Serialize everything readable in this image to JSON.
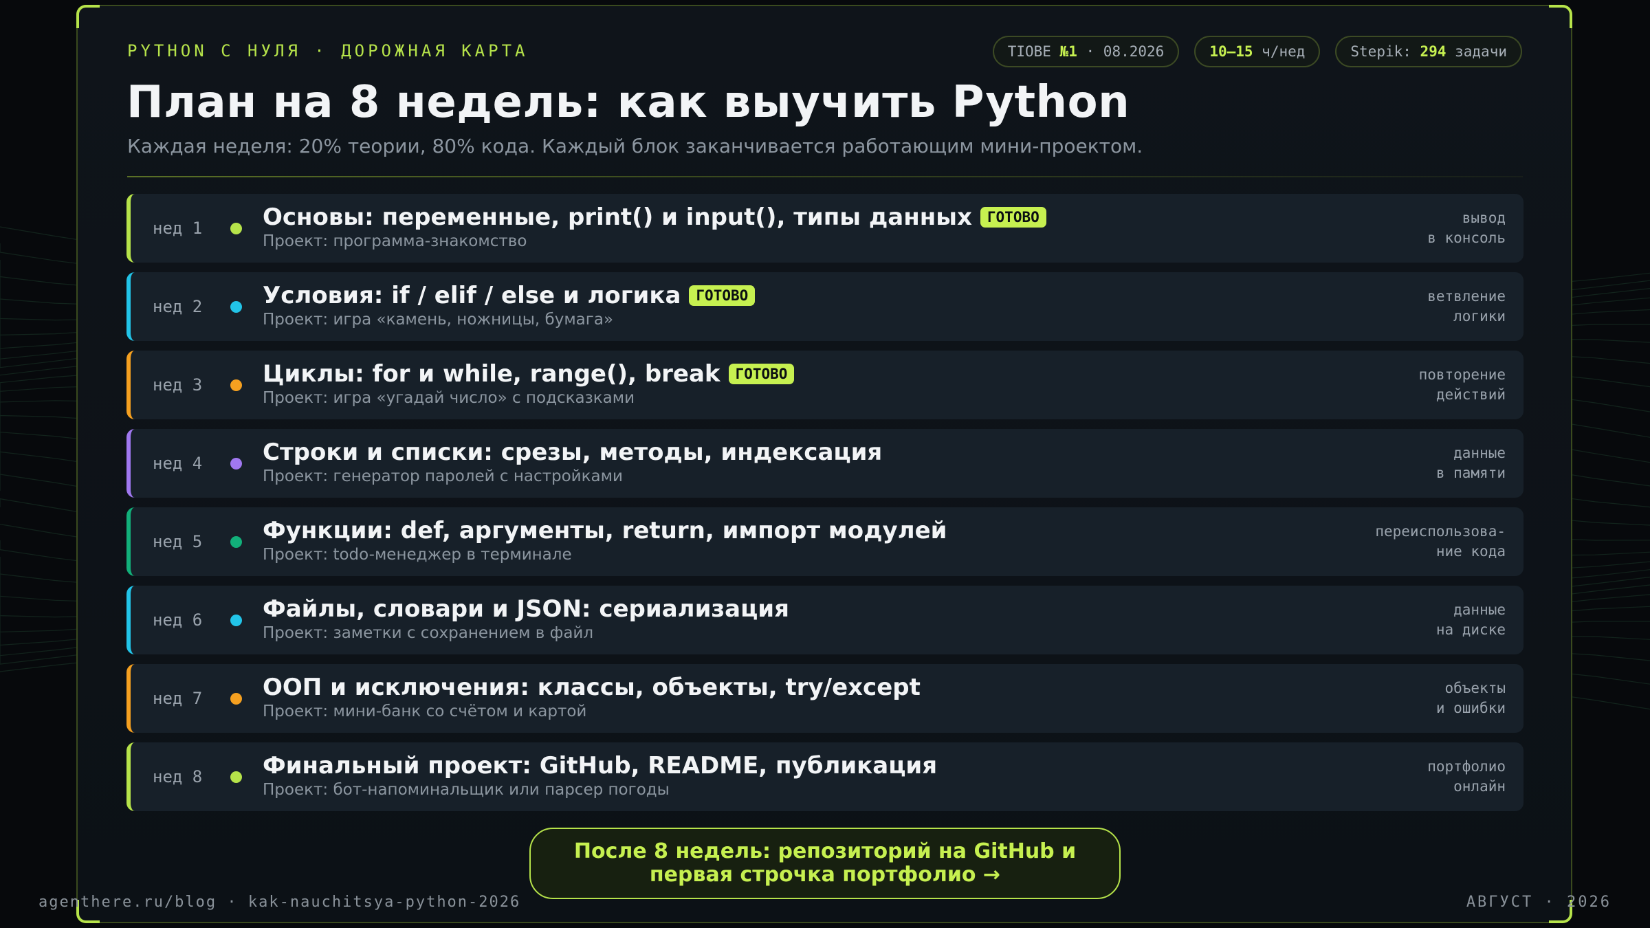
{
  "header": {
    "kicker": "PYTHON С НУЛЯ · ДОРОЖНАЯ КАРТА",
    "pills": [
      {
        "pre": "TIOBE ",
        "bold": "№1",
        "post": " · 08.2026"
      },
      {
        "pre": "",
        "bold": "10–15",
        "post": " ч/нед"
      },
      {
        "pre": "Stepik: ",
        "bold": "294",
        "post": " задачи"
      }
    ],
    "title": "План на 8 недель: как выучить Python",
    "subtitle": "Каждая неделя: 20% теории, 80% кода. Каждый блок заканчивается работающим мини-проектом."
  },
  "weeks": [
    {
      "label": "нед 1",
      "title": "Основы: переменные, print() и input(), типы данных",
      "badge": "ГОТОВО",
      "project": "Проект: программа-знакомство",
      "tag": [
        "вывод",
        "в консоль"
      ],
      "color": "#b6e34a"
    },
    {
      "label": "нед 2",
      "title": "Условия: if / elif / else и логика",
      "badge": "ГОТОВО",
      "project": "Проект: игра «камень, ножницы, бумага»",
      "tag": [
        "ветвление",
        "логики"
      ],
      "color": "#22c4e8"
    },
    {
      "label": "нед 3",
      "title": "Циклы: for и while, range(), break",
      "badge": "ГОТОВО",
      "project": "Проект: игра «угадай число» с подсказками",
      "tag": [
        "повторение",
        "действий"
      ],
      "color": "#f5a020"
    },
    {
      "label": "нед 4",
      "title": "Строки и списки: срезы, методы, индексация",
      "badge": "",
      "project": "Проект: генератор паролей с настройками",
      "tag": [
        "данные",
        "в памяти"
      ],
      "color": "#a078f0"
    },
    {
      "label": "нед 5",
      "title": "Функции: def, аргументы, return, импорт модулей",
      "badge": "",
      "project": "Проект: todo-менеджер в терминале",
      "tag": [
        "переиспользова-",
        "ние кода"
      ],
      "color": "#12b07a"
    },
    {
      "label": "нед 6",
      "title": "Файлы, словари и JSON: сериализация",
      "badge": "",
      "project": "Проект: заметки с сохранением в файл",
      "tag": [
        "данные",
        "на диске"
      ],
      "color": "#22c4e8"
    },
    {
      "label": "нед 7",
      "title": "ООП и исключения: классы, объекты, try/except",
      "badge": "",
      "project": "Проект: мини-банк со счётом и картой",
      "tag": [
        "объекты",
        "и ошибки"
      ],
      "color": "#f5a020"
    },
    {
      "label": "нед 8",
      "title": "Финальный проект: GitHub, README, публикация",
      "badge": "",
      "project": "Проект: бот-напоминальщик или парсер погоды",
      "tag": [
        "портфолио",
        "онлайн"
      ],
      "color": "#b6e34a"
    }
  ],
  "cta": {
    "line1": "После 8 недель: репозиторий на GitHub и",
    "line2": "первая строчка портфолио →"
  },
  "footer": {
    "left": "agenthere.ru/blog · kak-nauchitsya-python-2026",
    "right": "АВГУСТ · 2026"
  }
}
